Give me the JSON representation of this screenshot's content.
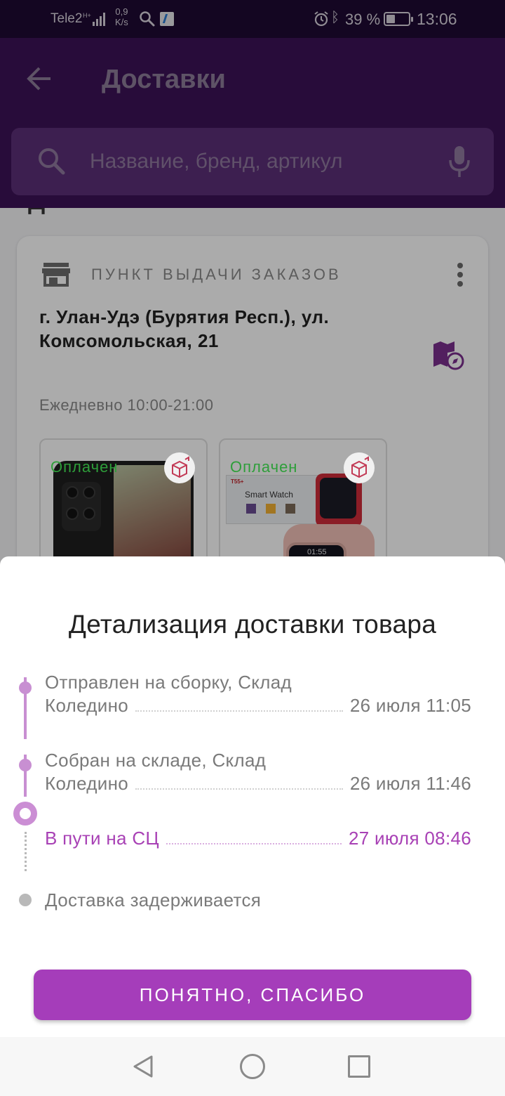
{
  "status_bar": {
    "carrier": "Tele2",
    "net_speed_value": "0,9",
    "net_speed_unit": "K/s",
    "battery": "39 %",
    "time": "13:06",
    "icons": [
      "signal-icon",
      "search-icon",
      "app-icon",
      "alarm-icon",
      "bluetooth-icon",
      "battery-icon"
    ]
  },
  "header": {
    "title": "Доставки",
    "search_placeholder": "Название, бренд, артикул"
  },
  "pickup": {
    "type_label": "ПУНКТ ВЫДАЧИ ЗАКАЗОВ",
    "address": "г. Улан-Удэ (Бурятия Респ.), ул. Комсомольская, 21",
    "hours": "Ежедневно 10:00-21:00",
    "products": [
      {
        "status": "Оплачен"
      },
      {
        "status": "Оплачен",
        "box_text": "Smart Watch",
        "box_brand": "T55+",
        "watch_time": "01:55"
      }
    ]
  },
  "sheet": {
    "title": "Детализация доставки товара",
    "events": [
      {
        "line1": "Отправлен на сборку, Склад",
        "line2": "Коледино",
        "date": "26 июля 11:05",
        "state": "done"
      },
      {
        "line1": "Собран на складе, Склад",
        "line2": "Коледино",
        "date": "26 июля 11:46",
        "state": "done"
      },
      {
        "line1": "В пути на СЦ",
        "date": "27 июля 08:46",
        "state": "current"
      },
      {
        "line1": "Доставка задерживается",
        "state": "pending"
      }
    ],
    "confirm_label": "ПОНЯТНО, СПАСИБО"
  },
  "colors": {
    "accent": "#a53dba",
    "timeline": "#c88fd2",
    "paid": "#2e9e3a",
    "header": "#3d1257"
  }
}
